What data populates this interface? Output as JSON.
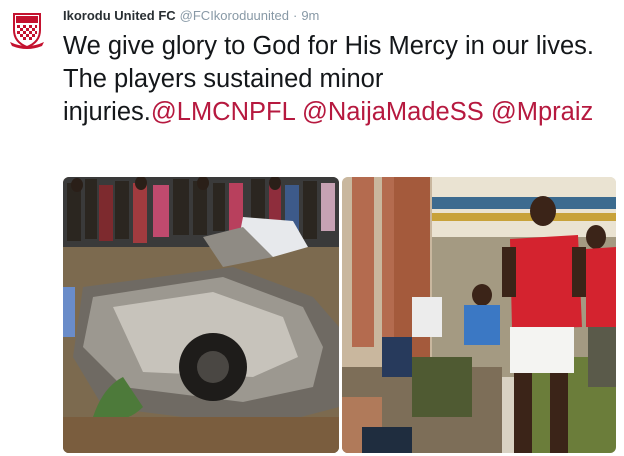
{
  "tweet": {
    "author_name": "Ikorodu United FC",
    "author_handle": "@FCIkoroduunited",
    "separator": "·",
    "time": "9m",
    "text_intro": "We give glory to God for His Mercy in our lives. The players sustained minor injuries.",
    "mentions": [
      "@LMCNPFL",
      "@NaijaMadeSS",
      "@Mpraiz"
    ]
  },
  "colors": {
    "mention": "#b6193f",
    "meta": "#8899a6",
    "logo_red": "#c4122f"
  },
  "icons": {
    "avatar": "club-crest-logo"
  }
}
